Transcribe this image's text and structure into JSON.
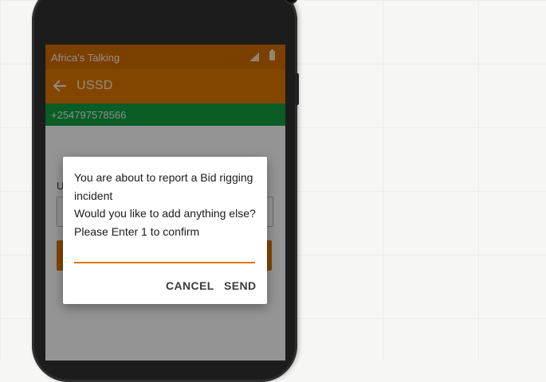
{
  "status_bar": {
    "title": "Africa's Talking",
    "icons": [
      "signal-icon",
      "battery-icon"
    ]
  },
  "toolbar": {
    "back_icon": "arrow-left-icon",
    "title": "USSD"
  },
  "number_bar": {
    "phone_number": "+254797578566"
  },
  "background_content": {
    "label_fragment": "U"
  },
  "dialog": {
    "message_line1": "You are about to report a Bid rigging incident",
    "message_line2": "Would you like to add anything else? Please Enter 1 to confirm",
    "input_value": "",
    "input_placeholder": "",
    "cancel_label": "CANCEL",
    "send_label": "SEND"
  },
  "colors": {
    "status_bar": "#d46d00",
    "toolbar": "#e07900",
    "number_bar": "#10a040",
    "accent": "#e07900"
  }
}
